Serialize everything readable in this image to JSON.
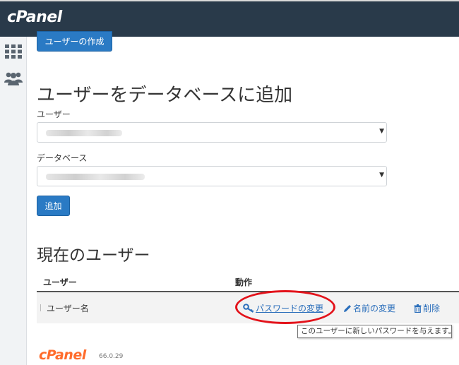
{
  "header": {
    "brand": "cPanel"
  },
  "sidebar": {
    "icons": [
      "grid-icon",
      "users-icon"
    ]
  },
  "create_button": "ユーザーの作成",
  "add_section": {
    "title": "ユーザーをデータベースに追加",
    "user_label": "ユーザー",
    "db_label": "データベース",
    "add_button": "追加"
  },
  "current_users": {
    "title": "現在のユーザー",
    "columns": [
      "ユーザー",
      "動作"
    ],
    "rows": [
      {
        "name": "ユーザー名",
        "actions": {
          "change_password": "パスワードの変更",
          "rename": "名前の変更",
          "delete": "削除"
        }
      }
    ]
  },
  "tooltip": "このユーザーに新しいパスワードを与えます。",
  "footer": {
    "brand": "cPanel",
    "version": "66.0.29"
  },
  "colors": {
    "topbar": "#293a4a",
    "primary": "#2a7ac4",
    "link": "#2a6ebb",
    "highlight": "#e3131b",
    "footer_brand": "#ff6c2c"
  }
}
